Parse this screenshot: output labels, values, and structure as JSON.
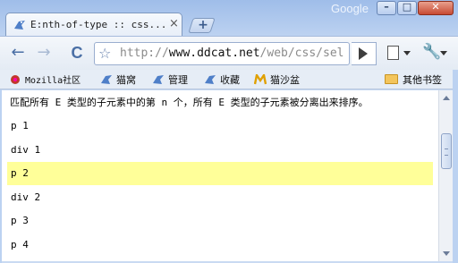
{
  "window": {
    "brand": "Google",
    "buttons": {
      "minimize": "–",
      "maximize": "□",
      "close": "✕"
    }
  },
  "tab": {
    "title": "E:nth-of-type :: css...",
    "close": "×",
    "favicon": "ddcat-bird-icon"
  },
  "new_tab_label": "+",
  "toolbar": {
    "back": "←",
    "forward": "→",
    "reload": "C",
    "star": "☆",
    "url_scheme": "http://",
    "url_host": "www.ddcat.net",
    "url_path": "/web/css/sel",
    "wrench": "🔧"
  },
  "bookmarks": [
    {
      "label": "Mozilla社区",
      "icon": "mozilla-icon"
    },
    {
      "label": "猫窝",
      "icon": "ddcat-bird-icon"
    },
    {
      "label": "管理",
      "icon": "ddcat-bird-icon"
    },
    {
      "label": "收藏",
      "icon": "ddcat-bird-icon"
    },
    {
      "label": "猫沙盆",
      "icon": "m-logo-icon"
    }
  ],
  "other_bookmarks": "其他书签",
  "page": {
    "intro": "匹配所有 E 类型的子元素中的第 n 个，所有 E 类型的子元素被分离出来排序。",
    "rows": [
      {
        "text": "p 1",
        "highlighted": false
      },
      {
        "text": "div 1",
        "highlighted": false
      },
      {
        "text": "p 2",
        "highlighted": true
      },
      {
        "text": "div 2",
        "highlighted": false
      },
      {
        "text": "p 3",
        "highlighted": false
      },
      {
        "text": "p 4",
        "highlighted": false
      }
    ],
    "highlight_color": "#ffff99"
  }
}
